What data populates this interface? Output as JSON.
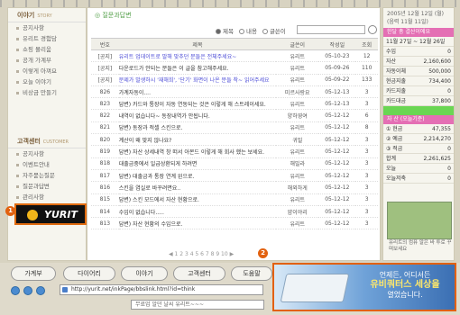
{
  "left_nav": {
    "section1_title": "이야기",
    "section1_sub": "STORY",
    "items": [
      "공지사항",
      "유리트 경험담",
      "쇼핑 몰리움",
      "공개 가계부",
      "이렇게 아껴요",
      "오늘 이야기",
      "비상금 만들기"
    ],
    "section2_title": "고객센터",
    "section2_sub": "CUSTOMER",
    "items2": [
      "공지사항",
      "이벤트안내",
      "자주묻는질문",
      "질문과답변",
      "관리사항"
    ]
  },
  "logo": {
    "text": "YURIT",
    "badge": "1"
  },
  "main": {
    "crumb": "◎ 질문과답변",
    "search_options": [
      "제목",
      "내용",
      "글쓴이"
    ],
    "headers": [
      "번호",
      "제목",
      "글쓴이",
      "작성일",
      "조회"
    ],
    "rows": [
      {
        "num": "[공지]",
        "title": "유리트 업데이트로 말해 맞추던 문들은 전체주세요~",
        "author": "유리트",
        "date": "05-10-23",
        "views": "12",
        "notice": true
      },
      {
        "num": "[공지]",
        "title": "다운로드가 안되는 분들은 이 글을 참고해주세요.",
        "author": "유리트",
        "date": "05-09-26",
        "views": "110",
        "notice": false
      },
      {
        "num": "[공지]",
        "title": "문제가 발생하시 '재해희', '단기' 화면이 나온 분들 착~ 읽어주세요",
        "author": "유리트",
        "date": "05-09-22",
        "views": "133",
        "notice": true
      },
      {
        "num": "826",
        "title": "가계자동이....",
        "author": "미르사랑요",
        "date": "05-12-13",
        "views": "3",
        "notice": false
      },
      {
        "num": "823",
        "title": "답변) 카드와 통장이 자동 연동되는 것은 이렇게 해 스트레이세요.",
        "author": "유리트",
        "date": "05-12-13",
        "views": "3",
        "notice": false
      },
      {
        "num": "822",
        "title": "내역이 없습니다~ 동장내역가 안됩니다.",
        "author": "양하영여",
        "date": "05-12-12",
        "views": "6",
        "notice": false
      },
      {
        "num": "821",
        "title": "답변) 동장과 적셀 스킨으로.",
        "author": "유리트",
        "date": "05-12-12",
        "views": "8",
        "notice": false
      },
      {
        "num": "820",
        "title": "계산이 왜 맞지 않나요?",
        "author": "귀밀",
        "date": "05-12-12",
        "views": "3",
        "notice": false
      },
      {
        "num": "819",
        "title": "답변) 자산 상세내역 창 떠서 아몬드 이렇게 해 회사 했는 보세요.",
        "author": "유리트",
        "date": "05-12-12",
        "views": "3",
        "notice": false
      },
      {
        "num": "818",
        "title": "대출금중에서 일급상환되게 하려면",
        "author": "해밀라",
        "date": "05-12-12",
        "views": "3",
        "notice": false
      },
      {
        "num": "817",
        "title": "답변) 대출금과 통장 연계 왼으로.",
        "author": "유리트",
        "date": "05-12-12",
        "views": "3",
        "notice": false
      },
      {
        "num": "816",
        "title": "스킨을 염실로 바꾸려면요..",
        "author": "해외하게",
        "date": "05-12-12",
        "views": "3",
        "notice": false
      },
      {
        "num": "815",
        "title": "답변) 스킨 모드에서 자산 현황으로.",
        "author": "유리트",
        "date": "05-12-12",
        "views": "3",
        "notice": false
      },
      {
        "num": "814",
        "title": "수입이 없습니다.....",
        "author": "얌이야리",
        "date": "05-12-12",
        "views": "3",
        "notice": false
      },
      {
        "num": "813",
        "title": "답변) 자산 현황의 수입으로.",
        "author": "유리트",
        "date": "05-12-12",
        "views": "3",
        "notice": false
      }
    ],
    "pager": "◀ 1 2 3 4 5 6 7 8 9 10 ▶"
  },
  "right": {
    "date": "2005년 12월 12일 (월)",
    "date_sub": "(음력 11월 11일)",
    "tag1": "한달 총 결산이에요",
    "period": "11월 27일 ~ 12월 26일",
    "rows1": [
      [
        "수입",
        "0"
      ],
      [
        "자산",
        "2,160,600"
      ],
      [
        "자동이체",
        "500,000"
      ],
      [
        "현금지출",
        "734,400"
      ],
      [
        "카드지출",
        "0"
      ],
      [
        "카드대금",
        "37,800"
      ]
    ],
    "tag2": "자 산 (오늘기준)",
    "rows2": [
      [
        "① 현금",
        "47,355"
      ],
      [
        "② 예금",
        "2,214,270"
      ],
      [
        "③ 적금",
        "0"
      ],
      [
        "합계",
        "2,261,625"
      ],
      [
        "오늘",
        "0"
      ],
      [
        "오늘저축",
        "0"
      ]
    ],
    "tree_caption": "유리트의 컴퓨 알은 바 투로 꾸며보세요"
  },
  "bottom": {
    "tabs": [
      "가계부",
      "다이어리",
      "이야기",
      "고객센터",
      "도움말"
    ],
    "url": "http://yurit.net/inkPage/bbslink.html?id=think",
    "status": "무료업 알던 날씨 유리트~~~",
    "badge": "2"
  },
  "ad": {
    "line1": "언제든, 어디서든",
    "line2": "유비쿼터스 세상을",
    "line3": "열었습니다."
  }
}
